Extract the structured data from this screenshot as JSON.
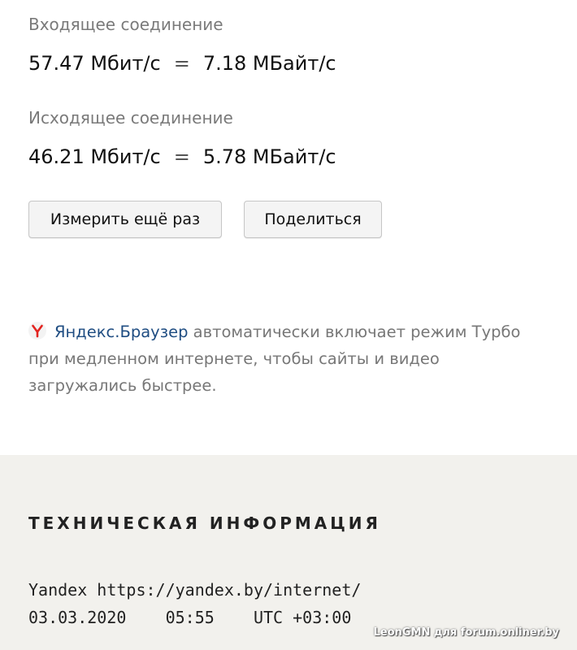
{
  "incoming": {
    "label": "Входящее соединение",
    "mbit": "57.47 Мбит/с",
    "equals": "=",
    "mbyte": "7.18 МБайт/с"
  },
  "outgoing": {
    "label": "Исходящее соединение",
    "mbit": "46.21 Мбит/с",
    "equals": "=",
    "mbyte": "5.78 МБайт/с"
  },
  "buttons": {
    "measure_again": "Измерить ещё раз",
    "share": "Поделиться"
  },
  "promo": {
    "icon": "yandex-logo-icon",
    "link_text": "Яндекс.Браузер",
    "text": " автоматически включает режим Турбо при медленном интернете, чтобы сайты и видео загружались быстрее."
  },
  "tech": {
    "title": "ТЕХНИЧЕСКАЯ ИНФОРМАЦИЯ",
    "line1": "Yandex https://yandex.by/internet/",
    "line2": "03.03.2020    05:55    UTC +03:00"
  },
  "watermark": "LeonGMN для forum.onliner.by",
  "colors": {
    "link": "#1f4d82",
    "logo_red": "#e32420",
    "bottom_bg": "#f2f1ed"
  }
}
